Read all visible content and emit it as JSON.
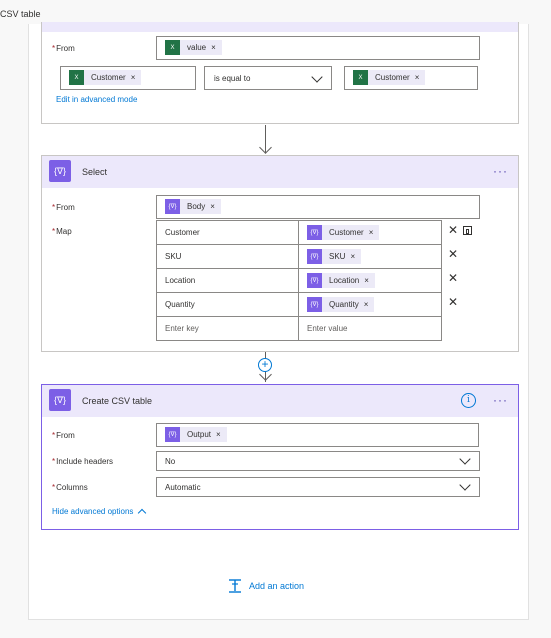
{
  "header": {
    "title": "CSV table"
  },
  "filter_card": {
    "from_label": "From",
    "from_token": "value",
    "condition": {
      "left_token": "Customer",
      "operator": "is equal to",
      "right_token": "Customer"
    },
    "edit_link": "Edit in advanced mode"
  },
  "select_card": {
    "title": "Select",
    "from_label": "From",
    "from_token": "Body",
    "map_label": "Map",
    "map_rows": [
      {
        "key": "Customer",
        "value": "Customer"
      },
      {
        "key": "SKU",
        "value": "SKU"
      },
      {
        "key": "Location",
        "value": "Location"
      },
      {
        "key": "Quantity",
        "value": "Quantity"
      }
    ],
    "key_placeholder": "Enter key",
    "value_placeholder": "Enter value"
  },
  "csv_card": {
    "title": "Create CSV table",
    "from_label": "From",
    "from_token": "Output",
    "headers_label": "Include headers",
    "headers_value": "No",
    "columns_label": "Columns",
    "columns_value": "Automatic",
    "hide_link": "Hide advanced options"
  },
  "add_action": {
    "label": "Add an action"
  },
  "icons": {
    "token_close": "×",
    "row_delete": "✕",
    "more": "···",
    "info": "i",
    "variable": "{∇}",
    "excel": "X"
  },
  "colors": {
    "accent": "#7c5fe6",
    "link": "#0078d4",
    "excel": "#217346"
  }
}
